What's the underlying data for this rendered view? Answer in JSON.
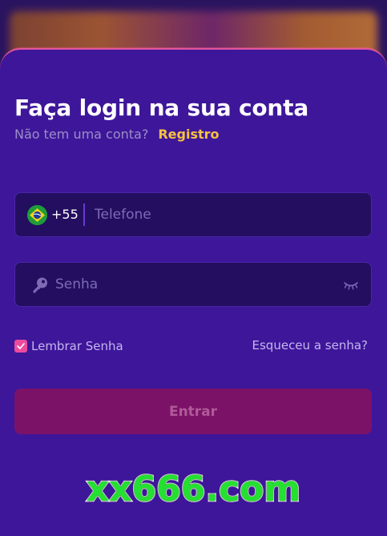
{
  "login": {
    "title": "Faça login na sua conta",
    "no_account_text": "Não tem uma conta?",
    "register_link": "Registro",
    "phone": {
      "flag_icon": "brazil-flag-icon",
      "country_code": "+55",
      "value": "",
      "placeholder": "Telefone"
    },
    "password": {
      "icon": "key-icon",
      "value": "",
      "placeholder": "Senha",
      "visibility_icon": "eye-closed-icon"
    },
    "remember": {
      "label": "Lembrar Senha",
      "checked": true
    },
    "forgot_link": "Esqueceu a senha?",
    "submit_label": "Entrar"
  },
  "watermark": "xx666.com",
  "colors": {
    "sheet_background": "#3e169a",
    "field_background": "#230e60",
    "accent_yellow": "#f6c242",
    "accent_pink": "#ec4b9d",
    "submit_background": "#7c1268",
    "watermark_green": "#24e030"
  }
}
